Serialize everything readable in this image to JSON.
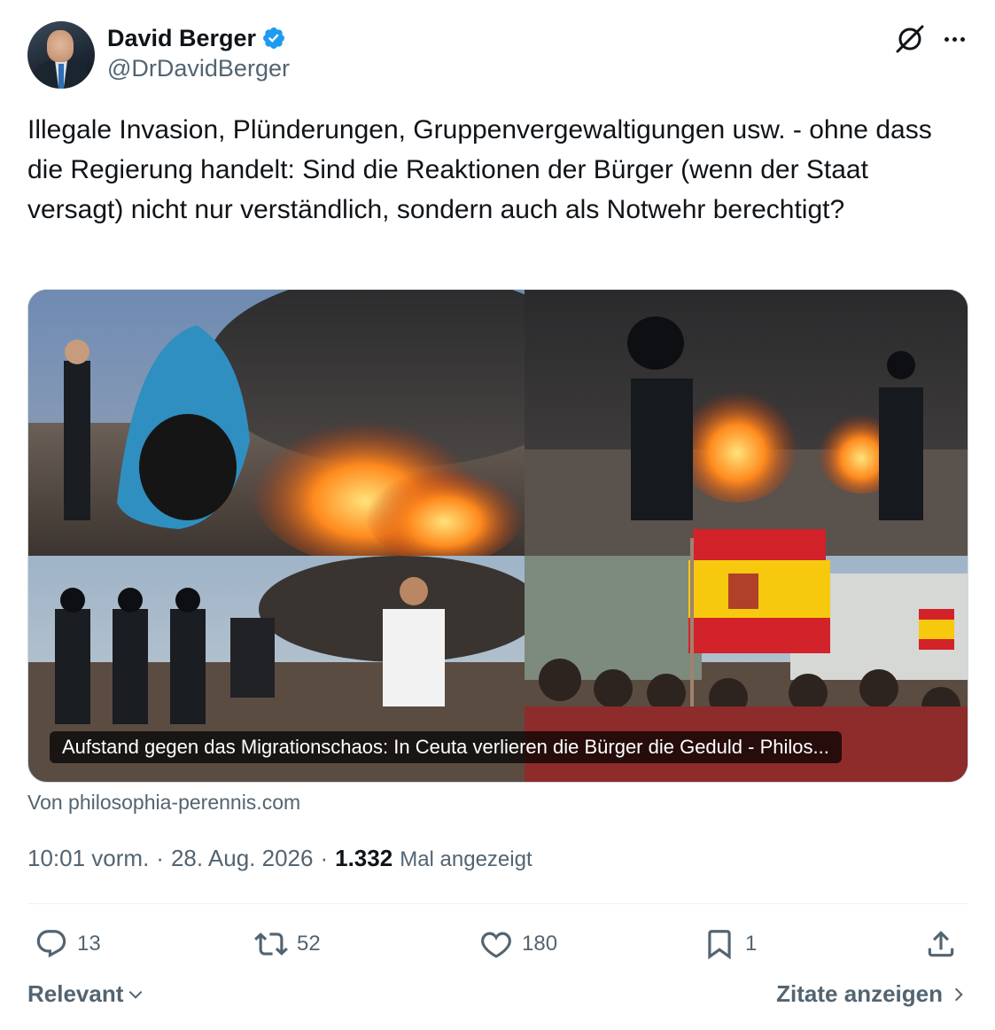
{
  "author": {
    "name": "David Berger",
    "handle": "@DrDavidBerger",
    "verified": true,
    "verified_color": "#1d9bf0"
  },
  "tweet": {
    "text": "Illegale Invasion, Plünderungen, Gruppenvergewaltigungen usw. - ohne dass die Regierung handelt: Sind die Reaktionen der Bürger (wenn der Staat versagt) nicht nur verständlich, sondern auch als Notwehr berechtigt?"
  },
  "card": {
    "caption": "Aufstand gegen das Migrationschaos: In Ceuta verlieren die Bürger die Geduld - Philos...",
    "source": "Von philosophia-perennis.com"
  },
  "meta": {
    "time": "10:01 vorm.",
    "separator": "·",
    "date": "28. Aug. 2026",
    "views": "1.332",
    "views_label": "Mal angezeigt"
  },
  "actions": {
    "replies": "13",
    "reposts": "52",
    "likes": "180",
    "bookmarks": "1"
  },
  "footer": {
    "sort_label": "Relevant",
    "quotes_label": "Zitate anzeigen"
  },
  "icons": [
    "grok-icon",
    "more-icon",
    "verified-badge-icon",
    "reply-icon",
    "repost-icon",
    "like-icon",
    "bookmark-icon",
    "share-icon",
    "chevron-down-icon",
    "chevron-right-icon"
  ]
}
